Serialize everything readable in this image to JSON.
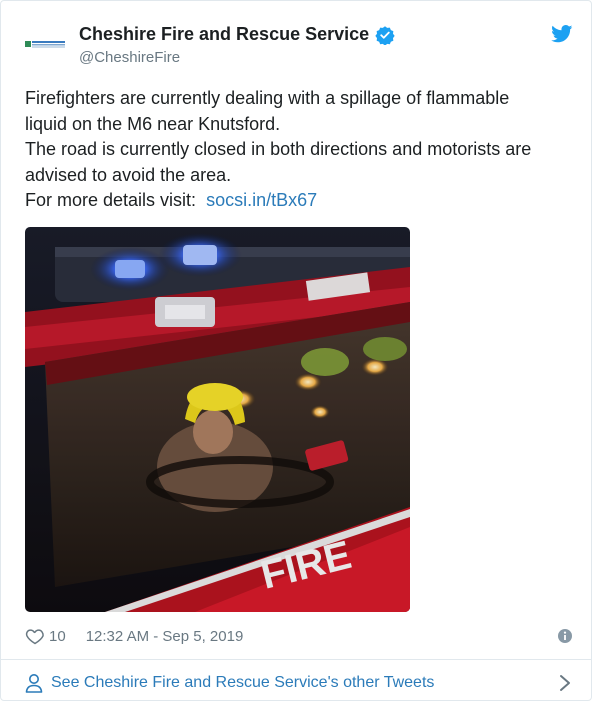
{
  "account": {
    "name": "Cheshire Fire and Rescue Service",
    "handle": "@CheshireFire",
    "verified": true,
    "avatar_icon": "cheshire-fire-logo-icon"
  },
  "tweet": {
    "lines": [
      "Firefighters are currently dealing with a spillage of flammable",
      "liquid on the M6 near Knutsford.",
      "The road is currently closed in both directions and motorists are",
      "advised to avoid the area."
    ],
    "link_prefix": "For more details visit:",
    "link_text": "socsi.in/tBx67"
  },
  "media": {
    "description_icon": "fire-engine-photo",
    "truck_text": "FIRE"
  },
  "meta": {
    "likes": "10",
    "timestamp": "12:32 AM - Sep 5, 2019"
  },
  "footer": {
    "label": "See Cheshire Fire and Rescue Service's other Tweets"
  },
  "colors": {
    "link": "#2b7bb9",
    "muted": "#697882",
    "text": "#1c2022",
    "verified": "#1da1f2"
  }
}
